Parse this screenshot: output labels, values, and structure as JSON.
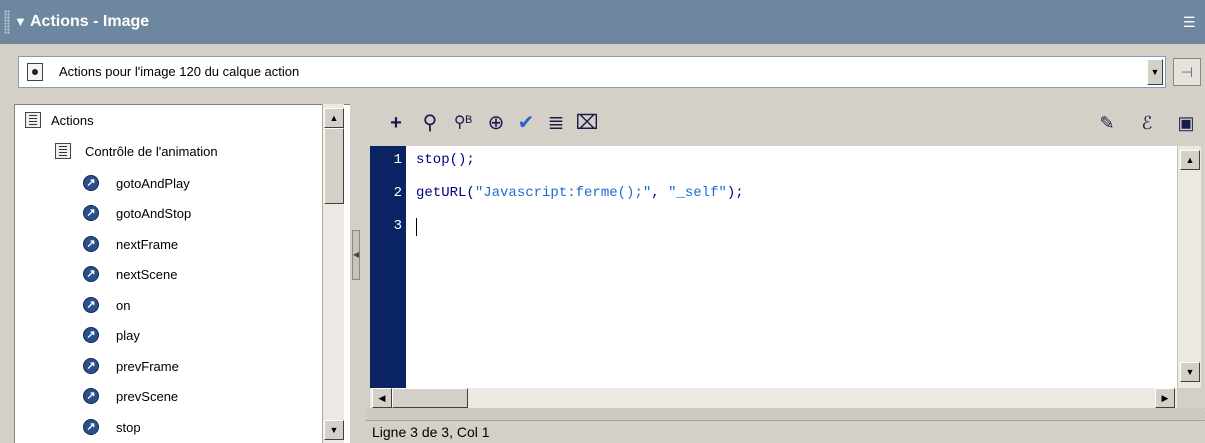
{
  "panel": {
    "title": "Actions - Image",
    "collapse_icon": "▼",
    "menu_icon": "☰"
  },
  "header": {
    "text": "Actions pour l'image 120 du calque action",
    "drop_icon": "▼",
    "pin_icon": "⊣"
  },
  "tree": {
    "root_label": "Actions",
    "category_label": "Contrôle de l'animation",
    "items": [
      "gotoAndPlay",
      "gotoAndStop",
      "nextFrame",
      "nextScene",
      "on",
      "play",
      "prevFrame",
      "prevScene",
      "stop"
    ]
  },
  "toolbar": {
    "icons": [
      "plus-icon",
      "find-icon",
      "replace-icon",
      "target-icon",
      "check-icon",
      "format-icon",
      "hint-icon",
      "reference-icon",
      "debug-icon",
      "view-options-icon"
    ]
  },
  "code": {
    "line_numbers": [
      "1",
      "2",
      "3"
    ],
    "line1": "stop();",
    "line2_pre": "getURL(",
    "line2_str1": "\"Javascript:ferme();\"",
    "line2_mid": ", ",
    "line2_str2": "\"_self\"",
    "line2_post": ");"
  },
  "status": {
    "text": "Ligne 3 de 3, Col 1"
  },
  "colors": {
    "titlebar": "#6d879f",
    "gutter": "#0a2463",
    "code": "#000080",
    "string": "#1d6bd6"
  }
}
